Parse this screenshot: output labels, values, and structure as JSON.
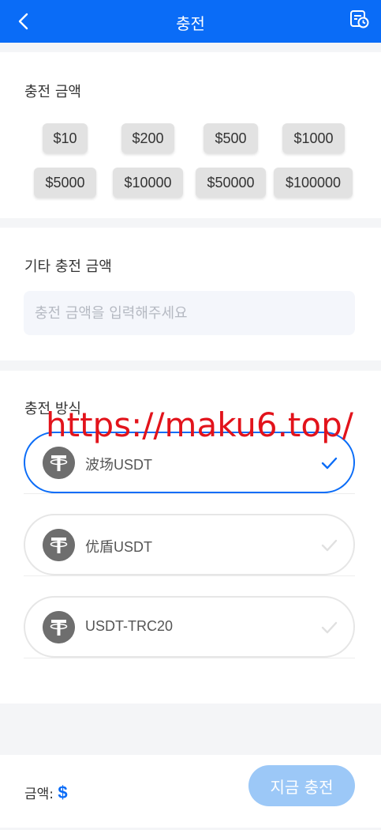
{
  "header": {
    "title": "충전",
    "back_icon": "chevron-left-icon",
    "history_icon": "calendar-clock-icon"
  },
  "preset_section": {
    "title": "충전 금액",
    "amounts": [
      "$10",
      "$200",
      "$500",
      "$1000",
      "$5000",
      "$10000",
      "$50000",
      "$100000"
    ]
  },
  "custom_section": {
    "title": "기타 충전 금액",
    "placeholder": "충전 금액을 입력해주세요",
    "value": ""
  },
  "method_section": {
    "title": "충전 방식",
    "methods": [
      {
        "name": "波场USDT",
        "selected": true,
        "icon": "tether-icon"
      },
      {
        "name": "优盾USDT",
        "selected": false,
        "icon": "tether-icon"
      },
      {
        "name": "USDT-TRC20",
        "selected": false,
        "icon": "tether-icon"
      }
    ]
  },
  "watermark": "https://maku6.top/",
  "footer": {
    "amount_label": "금액:",
    "currency": "$",
    "submit_label": "지금 충전"
  },
  "colors": {
    "brand": "#0a6cf7",
    "button_disabled": "#9cc8f7",
    "watermark": "#e2131b"
  }
}
